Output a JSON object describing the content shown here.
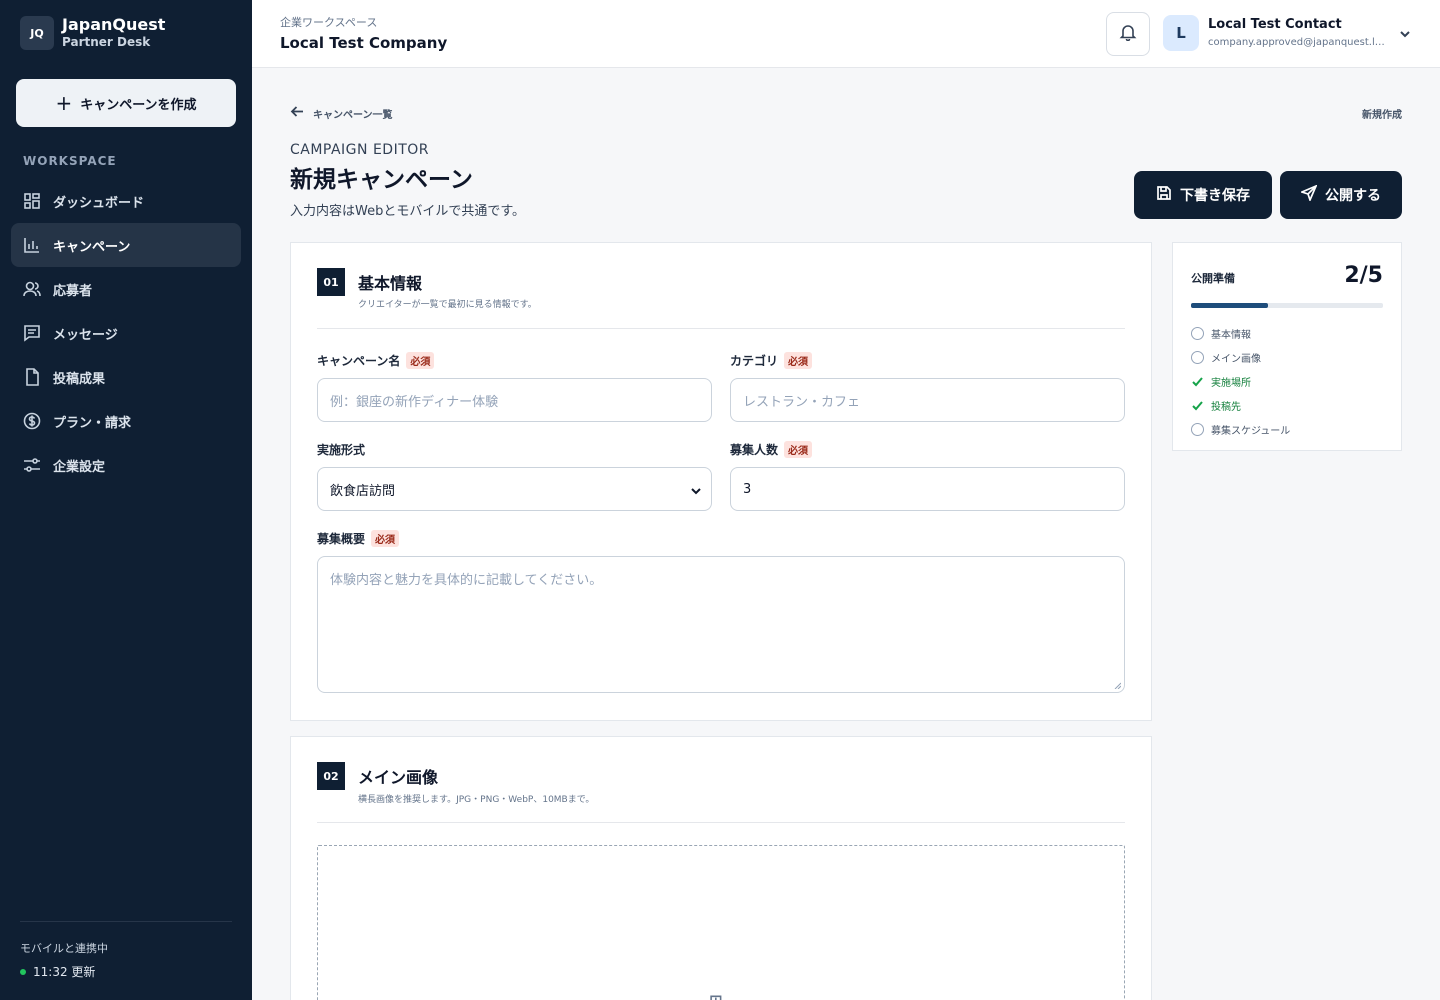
{
  "brand": {
    "logo_text": "JQ",
    "name": "JapanQuest",
    "sub": "Partner Desk"
  },
  "sidebar": {
    "create_label": "キャンペーンを作成",
    "section_label": "WORKSPACE",
    "items": [
      {
        "label": "ダッシュボード",
        "icon": "dashboard-icon",
        "active": false
      },
      {
        "label": "キャンペーン",
        "icon": "bar-chart-icon",
        "active": true
      },
      {
        "label": "応募者",
        "icon": "users-icon",
        "active": false
      },
      {
        "label": "メッセージ",
        "icon": "message-icon",
        "active": false
      },
      {
        "label": "投稿成果",
        "icon": "document-icon",
        "active": false
      },
      {
        "label": "プラン・請求",
        "icon": "dollar-icon",
        "active": false
      },
      {
        "label": "企業設定",
        "icon": "settings-icon",
        "active": false
      }
    ],
    "sync_label": "モバイルと連携中",
    "sync_time": "11:32 更新"
  },
  "header": {
    "workspace_label": "企業ワークスペース",
    "company": "Local Test Company",
    "user_initial": "L",
    "user_name": "Local Test Contact",
    "user_email": "company.approved@japanquest.local"
  },
  "page": {
    "back_label": "キャンペーン一覧",
    "status": "新規作成",
    "eyebrow": "CAMPAIGN EDITOR",
    "title": "新規キャンペーン",
    "subtitle": "入力内容はWebとモバイルで共通です。",
    "save_label": "下書き保存",
    "publish_label": "公開する"
  },
  "section1": {
    "number": "01",
    "title": "基本情報",
    "desc": "クリエイターが一覧で最初に見る情報です。",
    "required_badge": "必須",
    "fields": {
      "name_label": "キャンペーン名",
      "name_placeholder": "例：銀座の新作ディナー体験",
      "category_label": "カテゴリ",
      "category_placeholder": "レストラン・カフェ",
      "format_label": "実施形式",
      "format_value": "飲食店訪問",
      "count_label": "募集人数",
      "count_value": "3",
      "summary_label": "募集概要",
      "summary_placeholder": "体験内容と魅力を具体的に記載してください。"
    }
  },
  "section2": {
    "number": "02",
    "title": "メイン画像",
    "desc": "横長画像を推奨します。JPG・PNG・WebP、10MBまで。"
  },
  "checklist": {
    "title": "公開準備",
    "count": "2/5",
    "progress": 0.4,
    "items": [
      {
        "label": "基本情報",
        "done": false
      },
      {
        "label": "メイン画像",
        "done": false
      },
      {
        "label": "実施場所",
        "done": true
      },
      {
        "label": "投稿先",
        "done": true
      },
      {
        "label": "募集スケジュール",
        "done": false
      }
    ]
  }
}
